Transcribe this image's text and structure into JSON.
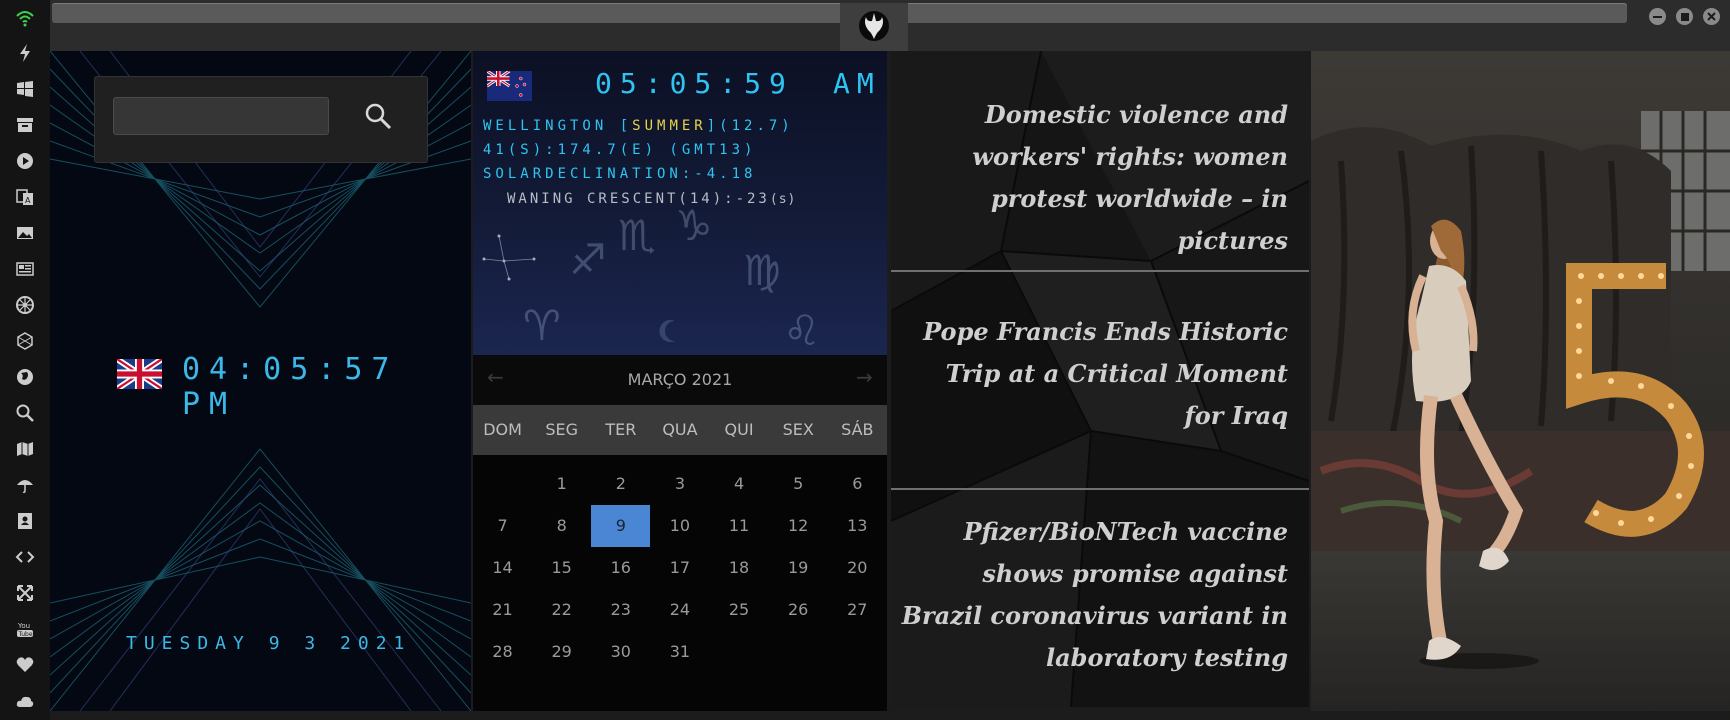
{
  "sidebar": {
    "icons": [
      "wifi-icon",
      "lightning-icon",
      "windows-icon",
      "archive-icon",
      "play-icon",
      "translate-icon",
      "image-icon",
      "newspaper-icon",
      "settings-wheel-icon",
      "hexagon-icon",
      "globe-icon",
      "search-icon",
      "map-icon",
      "umbrella-icon",
      "contacts-icon",
      "code-icon",
      "expand-icon",
      "youtube-icon",
      "heart-icon",
      "cloud-icon"
    ]
  },
  "topbar": {
    "tab_icon": "rebel-alliance-icon",
    "window_controls": [
      "minimize",
      "maximize",
      "close"
    ]
  },
  "uk_clock": {
    "time": "04:05:57 PM",
    "date": "TUESDAY 9 3 2021"
  },
  "search": {
    "value": "",
    "placeholder": ""
  },
  "nz_clock": {
    "time": "05:05:59",
    "ampm": "AM",
    "line1_a": "WELLINGTON [",
    "line1_season": "SUMMER",
    "line1_b": "](12.7)",
    "line2": "41(S):174.7(E) (GMT13)",
    "line3": "SOLARDECLINATION:-4.18",
    "moon": "WANING CRESCENT(14):-23",
    "moon_suffix": "(s)"
  },
  "calendar": {
    "title": "MARÇO 2021",
    "weekdays": [
      "DOM",
      "SEG",
      "TER",
      "QUA",
      "QUI",
      "SEX",
      "SÁB"
    ],
    "weeks": [
      [
        "",
        "1",
        "2",
        "3",
        "4",
        "5",
        "6"
      ],
      [
        "7",
        "8",
        "9",
        "10",
        "11",
        "12",
        "13"
      ],
      [
        "14",
        "15",
        "16",
        "17",
        "18",
        "19",
        "20"
      ],
      [
        "21",
        "22",
        "23",
        "24",
        "25",
        "26",
        "27"
      ],
      [
        "28",
        "29",
        "30",
        "31",
        "",
        "",
        ""
      ]
    ],
    "selected": "9"
  },
  "news": {
    "items": [
      "Domestic violence and workers' rights: women protest worldwide – in pictures",
      "Pope Francis Ends Historic Trip at a Critical Moment for Iraq",
      "Pfizer/BioNTech vaccine shows promise against Brazil coronavirus variant in laboratory testing"
    ]
  },
  "photo": {
    "text": "5"
  }
}
